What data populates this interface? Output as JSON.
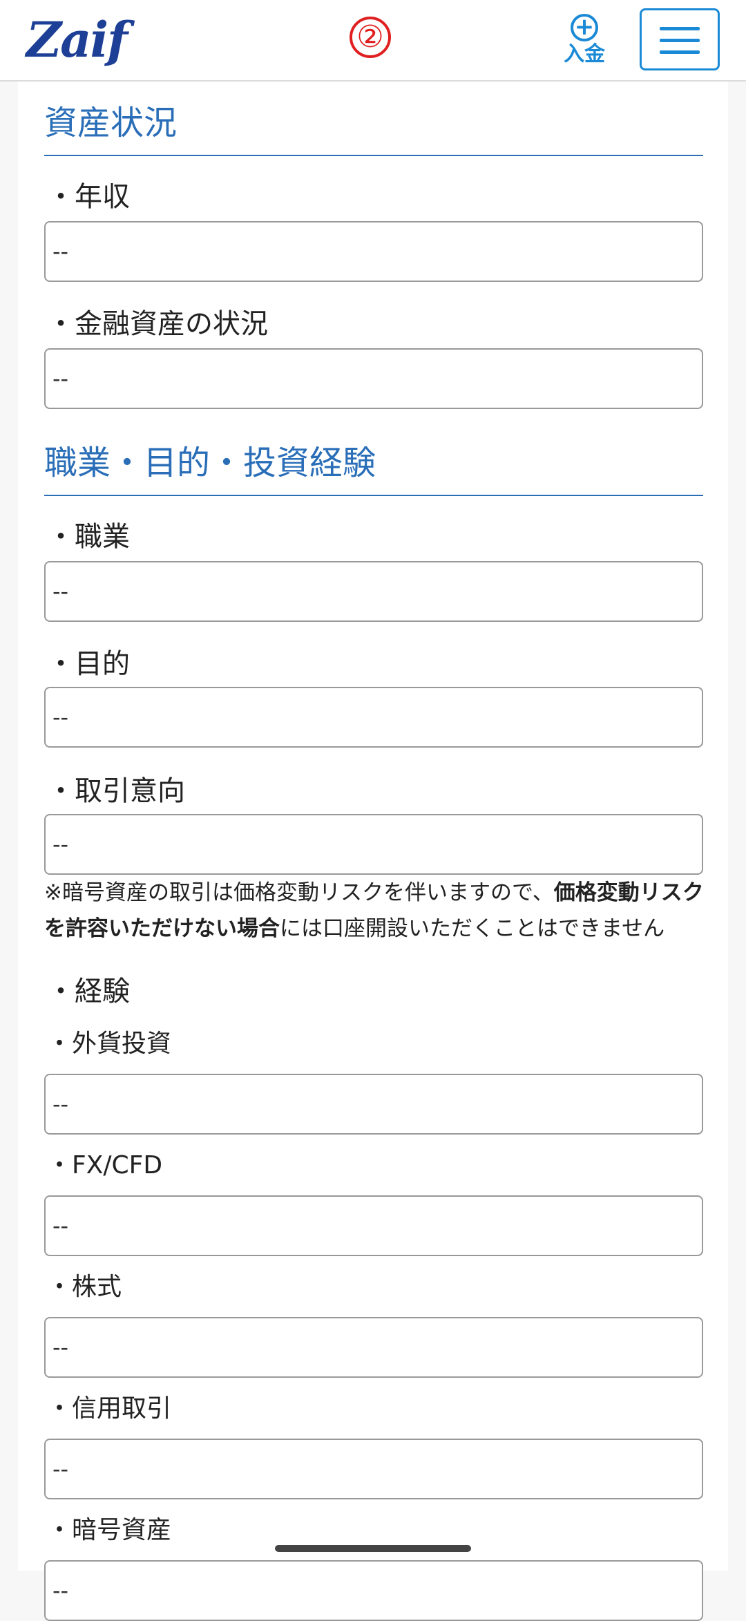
{
  "header": {
    "logo": "Zaif",
    "step": "②",
    "deposit_label": "入金"
  },
  "sections": {
    "assets": {
      "title": "資産状況",
      "fields": [
        {
          "label": "・年収",
          "value": "--"
        },
        {
          "label": "・金融資産の状況",
          "value": "--"
        }
      ]
    },
    "occupation": {
      "title": "職業・目的・投資経験",
      "fields": [
        {
          "label": "・職業",
          "value": "--"
        },
        {
          "label": "・目的",
          "value": "--"
        },
        {
          "label": "・取引意向",
          "value": "--"
        }
      ],
      "note_prefix": "※暗号資産の取引は価格変動リスクを伴いますので、",
      "note_bold": "価格変動リスクを許容いただけない場合",
      "note_suffix": "には口座開設いただくことはできません"
    },
    "experience": {
      "label": "・経験",
      "items": [
        {
          "label": "・外貨投資",
          "value": "--"
        },
        {
          "label": "・FX/CFD",
          "value": "--"
        },
        {
          "label": "・株式",
          "value": "--"
        },
        {
          "label": "・信用取引",
          "value": "--"
        },
        {
          "label": "・暗号資産",
          "value": "--"
        }
      ]
    }
  }
}
